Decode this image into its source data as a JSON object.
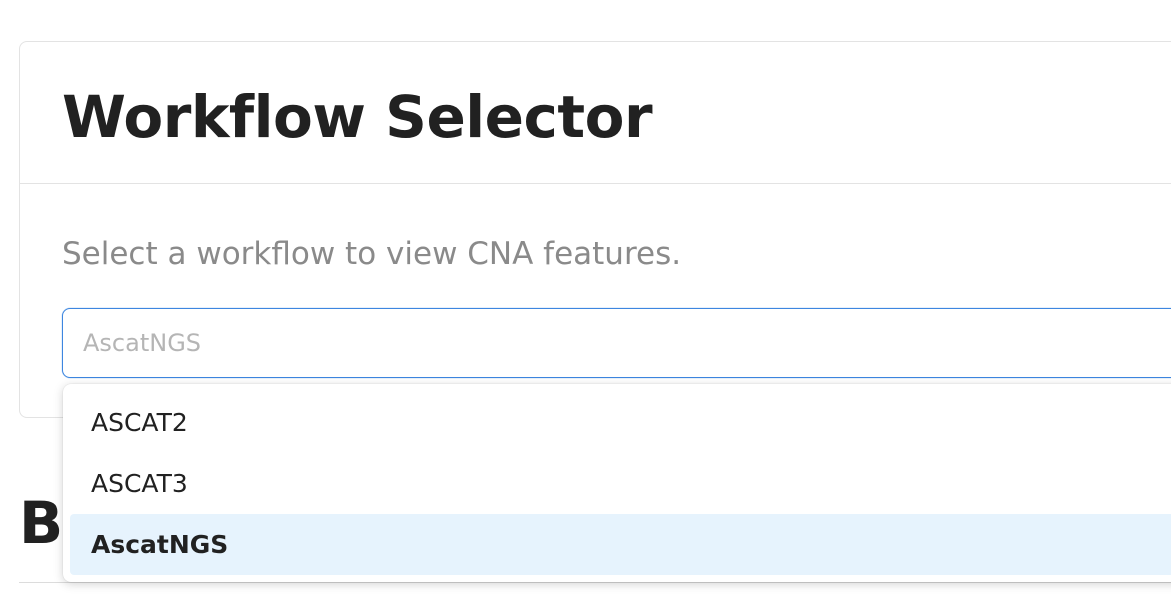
{
  "card": {
    "title": "Workflow Selector",
    "help_text": "Select a workflow to view CNA features.",
    "select": {
      "placeholder": "AscatNGS",
      "value": ""
    }
  },
  "background": {
    "heading_fragment": "B"
  },
  "dropdown": {
    "options": [
      {
        "label": "ASCAT2",
        "selected": false
      },
      {
        "label": "ASCAT3",
        "selected": false
      },
      {
        "label": "AscatNGS",
        "selected": true
      }
    ]
  },
  "colors": {
    "focus_border": "#3d86e0",
    "selected_option_bg": "#e6f3fd",
    "help_text": "#8a8a8a",
    "placeholder": "#b5b5b5"
  }
}
